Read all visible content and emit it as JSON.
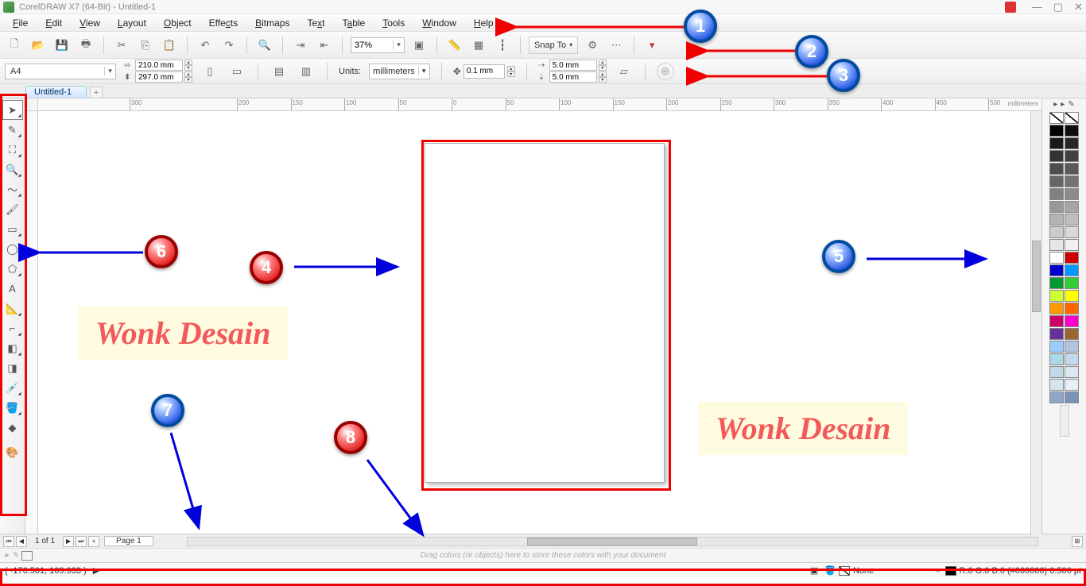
{
  "title": "CorelDRAW X7 (64-Bit) - Untitled-1",
  "menu": [
    "File",
    "Edit",
    "View",
    "Layout",
    "Object",
    "Effects",
    "Bitmaps",
    "Text",
    "Table",
    "Tools",
    "Window",
    "Help"
  ],
  "toolbar": {
    "zoom_value": "37%",
    "snap_label": "Snap To"
  },
  "propbar": {
    "page_size": "A4",
    "width": "210.0 mm",
    "height": "297.0 mm",
    "units_label": "Units:",
    "units_value": "millimeters",
    "nudge": "0.1 mm",
    "dup_h": "5.0 mm",
    "dup_v": "5.0 mm"
  },
  "doctab": "Untitled-1",
  "ruler": {
    "unit_label": "millimeters",
    "ticks": [
      "-300",
      "-200",
      "-150",
      "-100",
      "-50",
      "0",
      "50",
      "100",
      "150",
      "200",
      "250",
      "300",
      "350",
      "400",
      "450",
      "500"
    ]
  },
  "pagenav": {
    "counter": "1 of 1",
    "page_tab": "Page 1"
  },
  "docpalette_hint": "Drag colors (or objects) here to store these colors with your document",
  "status": {
    "coords": "( -176.501, 109.933 )",
    "fill_label": "None",
    "outline_label": "R:0 G:0 B:0 (#000000) 0.500 pt"
  },
  "annotations": {
    "wonk_label": "Wonk Desain",
    "badges": {
      "1": "1",
      "2": "2",
      "3": "3",
      "4": "4",
      "5": "5",
      "6": "6",
      "7": "7",
      "8": "8"
    }
  },
  "palette_colors_left": [
    "none",
    "#000000",
    "#1a1a1a",
    "#333333",
    "#4d4d4d",
    "#666666",
    "#808080",
    "#999999",
    "#b3b3b3",
    "#cccccc",
    "#e6e6e6",
    "#ffffff",
    "#0000cc",
    "#009933",
    "#ccff33",
    "#ff9900",
    "#cc0066",
    "#663399",
    "#99ccff",
    "#add8e6",
    "#c0d9e6",
    "#d6e4f0",
    "#8fa8c8"
  ],
  "palette_colors_right": [
    "none",
    "#0d0d0d",
    "#262626",
    "#404040",
    "#595959",
    "#737373",
    "#8c8c8c",
    "#a6a6a6",
    "#bfbfbf",
    "#d9d9d9",
    "#f2f2f2",
    "#cc0000",
    "#0099ff",
    "#33cc33",
    "#ffff00",
    "#ff6600",
    "#ff00cc",
    "#996633",
    "#b0c4de",
    "#c6d9ec",
    "#dce7f3",
    "#e8eff8",
    "#7a93b8"
  ]
}
